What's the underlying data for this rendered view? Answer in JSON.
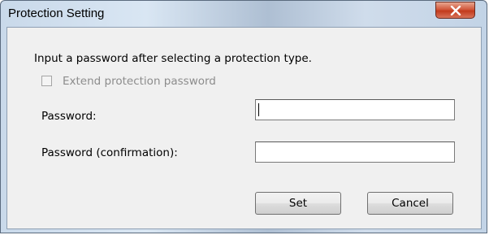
{
  "window": {
    "title": "Protection Setting"
  },
  "dialog": {
    "instruction": "Input a password after selecting a protection type.",
    "extend_checkbox_label": "Extend protection password",
    "extend_checkbox_checked": false,
    "extend_checkbox_enabled": false,
    "password_label": "Password:",
    "password_value": "",
    "password_confirmation_label": "Password (confirmation):",
    "password_confirmation_value": ""
  },
  "buttons": {
    "set_label": "Set",
    "cancel_label": "Cancel"
  },
  "icons": {
    "close": "close-icon"
  },
  "colors": {
    "close_button": "#c7442a",
    "disabled_text": "#8c8c8c",
    "dialog_background": "#f0f0f0"
  }
}
